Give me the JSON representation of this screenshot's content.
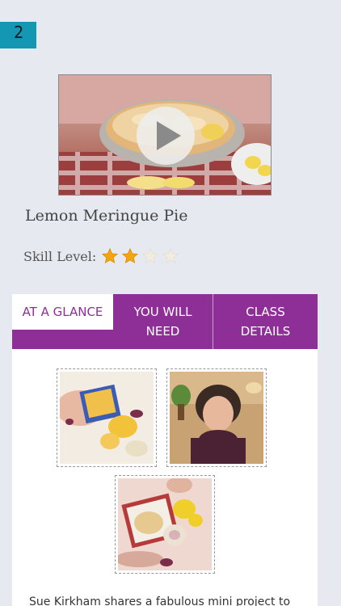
{
  "badge": {
    "number": "2"
  },
  "video": {
    "play_icon": "play-icon"
  },
  "lesson": {
    "title": "Lemon Meringue Pie",
    "skill_label": "Skill Level:",
    "skill_rating": 2,
    "skill_max": 4,
    "star_color": "#f4a40f"
  },
  "tabs": [
    {
      "label": "AT A GLANCE",
      "active": true
    },
    {
      "label": "YOU WILL NEED",
      "active": false
    },
    {
      "label": "CLASS DETAILS",
      "active": false
    }
  ],
  "colors": {
    "accent": "#8e2f98",
    "badge": "#1497b3"
  },
  "description": "Sue Kirkham shares a fabulous mini project to"
}
